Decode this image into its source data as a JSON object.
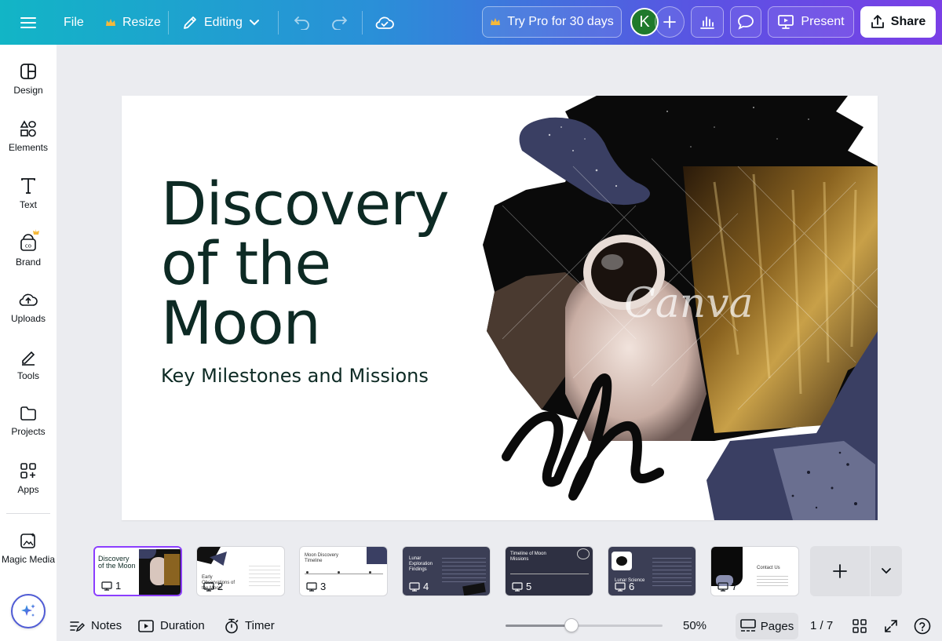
{
  "topbar": {
    "file_label": "File",
    "resize_label": "Resize",
    "editing_label": "Editing",
    "try_pro_label": "Try Pro for 30 days",
    "avatar_initial": "K",
    "present_label": "Present",
    "share_label": "Share"
  },
  "sidebar": {
    "items": [
      {
        "label": "Design",
        "icon": "design-icon"
      },
      {
        "label": "Elements",
        "icon": "elements-icon"
      },
      {
        "label": "Text",
        "icon": "text-icon"
      },
      {
        "label": "Brand",
        "icon": "brand-icon"
      },
      {
        "label": "Uploads",
        "icon": "uploads-icon"
      },
      {
        "label": "Tools",
        "icon": "tools-icon"
      },
      {
        "label": "Projects",
        "icon": "folder-icon"
      },
      {
        "label": "Apps",
        "icon": "apps-icon"
      },
      {
        "label": "Magic Media",
        "icon": "magic-media-icon"
      }
    ]
  },
  "slide": {
    "title": "Discovery of the Moon",
    "subtitle": "Key Milestones and Missions",
    "watermark": "Canva"
  },
  "thumbnails": [
    {
      "num": "1",
      "title": "Discovery of the Moon"
    },
    {
      "num": "2",
      "title": "Early Observations of the Moon"
    },
    {
      "num": "3",
      "title": "Moon Discovery Timeline"
    },
    {
      "num": "4",
      "title": "Lunar Exploration Findings"
    },
    {
      "num": "5",
      "title": "Timeline of Moon Missions"
    },
    {
      "num": "6",
      "title": "Lunar Science"
    },
    {
      "num": "7",
      "title": "Contact Us"
    }
  ],
  "bottombar": {
    "notes_label": "Notes",
    "duration_label": "Duration",
    "timer_label": "Timer",
    "zoom_value": "50%",
    "zoom_fraction": 0.42,
    "pages_label": "Pages",
    "page_indicator": "1 / 7"
  },
  "colors": {
    "accent": "#8b3dff",
    "title_text": "#0d2a24",
    "avatar_bg": "#1f7a2c",
    "navy_shape": "#3a3f63"
  }
}
